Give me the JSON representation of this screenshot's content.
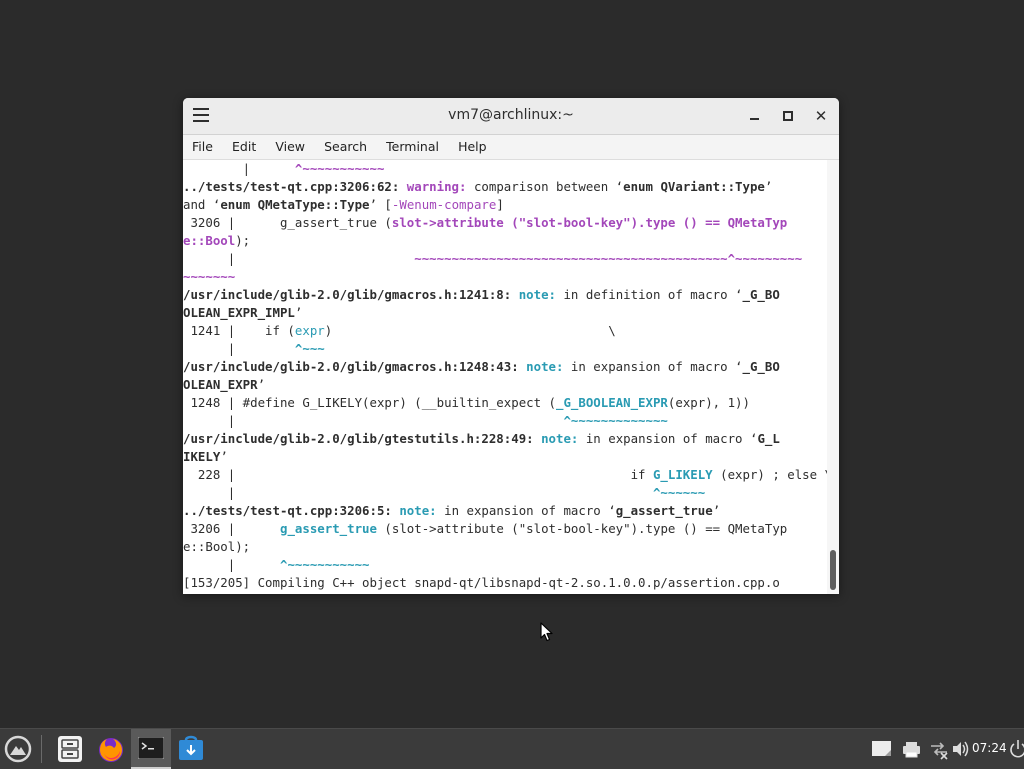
{
  "window": {
    "title": "vm7@archlinux:~",
    "close_glyph": "✕"
  },
  "menu": [
    "File",
    "Edit",
    "View",
    "Search",
    "Terminal",
    "Help"
  ],
  "terminal_lines": [
    [
      {
        "t": "        |      ",
        "c": "plain"
      },
      {
        "t": "^~~~~~~~~~~~",
        "c": "magb"
      }
    ],
    [
      {
        "t": "../tests/test-qt.cpp:3206:62: ",
        "c": "bold"
      },
      {
        "t": "warning:",
        "c": "magb"
      },
      {
        "t": " comparison between ‘",
        "c": "plain"
      },
      {
        "t": "enum QVariant::Type",
        "c": "bold"
      },
      {
        "t": "’",
        "c": "plain"
      }
    ],
    [
      {
        "t": "and ‘",
        "c": "plain"
      },
      {
        "t": "enum QMetaType::Type",
        "c": "bold"
      },
      {
        "t": "’ [",
        "c": "plain"
      },
      {
        "t": "-Wenum-compare",
        "c": "magenta"
      },
      {
        "t": "]",
        "c": "plain"
      }
    ],
    [
      {
        "t": " 3206 |      g_assert_true (",
        "c": "plain"
      },
      {
        "t": "slot->attribute (\"slot-bool-key\").type () == QMetaTyp",
        "c": "magb"
      }
    ],
    [
      {
        "t": "e::Bool",
        "c": "magb"
      },
      {
        "t": ");",
        "c": "plain"
      }
    ],
    [
      {
        "t": "      |                        ",
        "c": "plain"
      },
      {
        "t": "~~~~~~~~~~~~~~~~~~~~~~~~~~~~~~~~~~~~~~~~~~^~~~~~~~~~",
        "c": "magb"
      }
    ],
    [
      {
        "t": "~~~~~~~",
        "c": "magb"
      }
    ],
    [
      {
        "t": "/usr/include/glib-2.0/glib/gmacros.h:1241:8: ",
        "c": "bold"
      },
      {
        "t": "note:",
        "c": "cyanb"
      },
      {
        "t": " in definition of macro ‘",
        "c": "plain"
      },
      {
        "t": "_G_BO",
        "c": "bold"
      }
    ],
    [
      {
        "t": "OLEAN_EXPR_IMPL",
        "c": "bold"
      },
      {
        "t": "’",
        "c": "plain"
      }
    ],
    [
      {
        "t": " 1241 |    if (",
        "c": "plain"
      },
      {
        "t": "expr",
        "c": "cyan"
      },
      {
        "t": ")                                     \\",
        "c": "plain"
      }
    ],
    [
      {
        "t": "      |        ",
        "c": "plain"
      },
      {
        "t": "^~~~",
        "c": "cyanb"
      }
    ],
    [
      {
        "t": "/usr/include/glib-2.0/glib/gmacros.h:1248:43: ",
        "c": "bold"
      },
      {
        "t": "note:",
        "c": "cyanb"
      },
      {
        "t": " in expansion of macro ‘",
        "c": "plain"
      },
      {
        "t": "_G_BO",
        "c": "bold"
      }
    ],
    [
      {
        "t": "OLEAN_EXPR",
        "c": "bold"
      },
      {
        "t": "’",
        "c": "plain"
      }
    ],
    [
      {
        "t": " 1248 | #define G_LIKELY(expr) (__builtin_expect (",
        "c": "plain"
      },
      {
        "t": "_G_BOOLEAN_EXPR",
        "c": "cyanb"
      },
      {
        "t": "(expr), 1))",
        "c": "plain"
      }
    ],
    [
      {
        "t": "      |                                            ",
        "c": "plain"
      },
      {
        "t": "^~~~~~~~~~~~~~",
        "c": "cyanb"
      }
    ],
    [
      {
        "t": "/usr/include/glib-2.0/glib/gtestutils.h:228:49: ",
        "c": "bold"
      },
      {
        "t": "note:",
        "c": "cyanb"
      },
      {
        "t": " in expansion of macro ‘",
        "c": "plain"
      },
      {
        "t": "G_L",
        "c": "bold"
      }
    ],
    [
      {
        "t": "IKELY",
        "c": "bold"
      },
      {
        "t": "’",
        "c": "plain"
      }
    ],
    [
      {
        "t": "  228 |                                                     if ",
        "c": "plain"
      },
      {
        "t": "G_LIKELY",
        "c": "cyanb"
      },
      {
        "t": " (expr) ; else \\",
        "c": "plain"
      }
    ],
    [
      {
        "t": "      |                                                        ",
        "c": "plain"
      },
      {
        "t": "^~~~~~~",
        "c": "cyanb"
      }
    ],
    [
      {
        "t": "../tests/test-qt.cpp:3206:5: ",
        "c": "bold"
      },
      {
        "t": "note:",
        "c": "cyanb"
      },
      {
        "t": " in expansion of macro ‘",
        "c": "plain"
      },
      {
        "t": "g_assert_true",
        "c": "bold"
      },
      {
        "t": "’",
        "c": "plain"
      }
    ],
    [
      {
        "t": " 3206 |      ",
        "c": "plain"
      },
      {
        "t": "g_assert_true",
        "c": "cyanb"
      },
      {
        "t": " (slot->attribute (\"slot-bool-key\").type () == QMetaTyp",
        "c": "plain"
      }
    ],
    [
      {
        "t": "e::Bool);",
        "c": "plain"
      }
    ],
    [
      {
        "t": "      |      ",
        "c": "plain"
      },
      {
        "t": "^~~~~~~~~~~~",
        "c": "cyanb"
      }
    ],
    [
      {
        "t": "[153/205] Compiling C++ object snapd-qt/libsnapd-qt-2.so.1.0.0.p/assertion.cpp.o",
        "c": "plain"
      }
    ]
  ],
  "taskbar": {
    "clock": "07:24"
  },
  "colors": {
    "desktop": "#2b2b2b",
    "taskbar": "#3b3b3b",
    "magenta": "#a347ba",
    "cyan": "#2a9bb3"
  }
}
